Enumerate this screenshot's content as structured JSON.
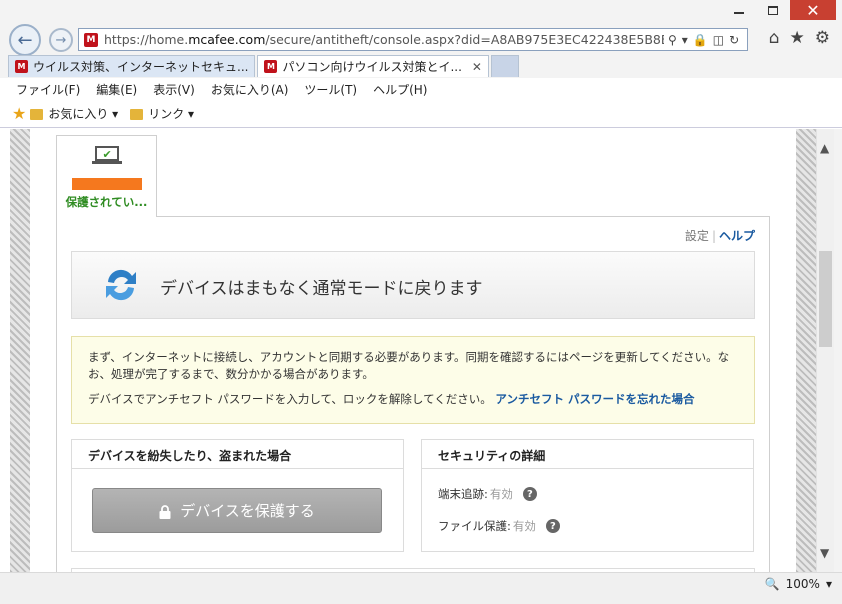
{
  "browser": {
    "url_prefix": "https://home.",
    "url_domain": "mcafee.com",
    "url_path": "/secure/antitheft/console.aspx?did=A8AB975E3EC422438E5B8BC3B4",
    "tabs": [
      {
        "label": "ウイルス対策、インターネットセキュ..."
      },
      {
        "label": "パソコン向けウイルス対策とイ...",
        "close": "✕"
      }
    ],
    "menu": [
      "ファイル(F)",
      "編集(E)",
      "表示(V)",
      "お気に入り(A)",
      "ツール(T)",
      "ヘルプ(H)"
    ],
    "favorites": {
      "favorites_label": "お気に入り",
      "links_label": "リンク"
    },
    "zoom": "100%"
  },
  "device": {
    "status": "保護されてい..."
  },
  "panel": {
    "settings_link": "設定",
    "help_link": "ヘルプ",
    "banner_title": "デバイスはまもなく通常モードに戻ります",
    "notice_line1": "まず、インターネットに接続し、アカウントと同期する必要があります。同期を確認するにはページを更新してください。なお、処理が完了するまで、数分かかる場合があります。",
    "notice_line2": "デバイスでアンチセフト パスワードを入力して、ロックを解除してください。",
    "notice_link": "アンチセフト パスワードを忘れた場合",
    "lost_box_title": "デバイスを紛失したり、盗まれた場合",
    "protect_button": "デバイスを保護する",
    "security_box_title": "セキュリティの詳細",
    "tracking_label": "端末追跡:",
    "tracking_value": "有効",
    "file_protect_label": "ファイル保護:",
    "file_protect_value": "有効"
  },
  "colors": {
    "accent_orange": "#f5781e",
    "status_green": "#2f8c22",
    "link_blue": "#1a5aa0",
    "close_red": "#c84031"
  }
}
